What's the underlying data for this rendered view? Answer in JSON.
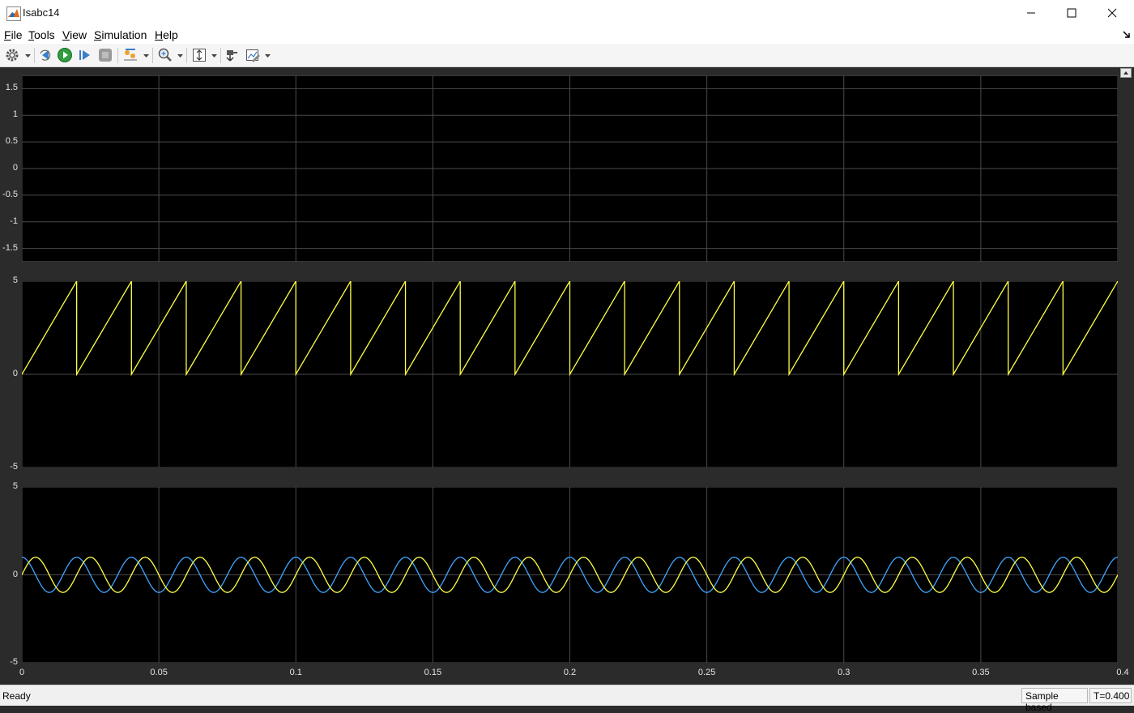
{
  "window": {
    "title": "Isabc14",
    "minimize_glyph": "—",
    "maximize_glyph": "☐",
    "close_glyph": "✕"
  },
  "menu": {
    "items": [
      {
        "first": "F",
        "rest": "ile"
      },
      {
        "first": "T",
        "rest": "ools"
      },
      {
        "first": "V",
        "rest": "iew"
      },
      {
        "first": "S",
        "rest": "imulation"
      },
      {
        "first": "H",
        "rest": "elp"
      }
    ]
  },
  "toolbar": {
    "icons": [
      "gear-icon",
      "step-back-icon",
      "run-icon",
      "step-forward-icon",
      "stop-icon",
      "signal-triggers-icon",
      "zoom-icon",
      "scale-axes-icon",
      "highlight-block-icon",
      "edit-axes-icon"
    ]
  },
  "status": {
    "left": "Ready",
    "sample_mode": "Sample based",
    "time": "T=0.400"
  },
  "colors": {
    "yellow": "#ffff44",
    "blue": "#3ea6ff",
    "axes_bg": "#000000",
    "grid": "#4a4a4a",
    "figure_bg": "#2b2b2b"
  },
  "chart_data": [
    {
      "type": "line",
      "x_ticks": [
        "0",
        "0.05",
        "0.1",
        "0.15",
        "0.2",
        "0.25",
        "0.3",
        "0.35",
        "0.4"
      ],
      "y_ticks": [
        "1.5",
        "1",
        "0.5",
        "0",
        "-0.5",
        "-1",
        "-1.5"
      ],
      "xlim": [
        0,
        0.4
      ],
      "ylim": [
        -1.75,
        1.75
      ],
      "grid": true,
      "series": []
    },
    {
      "type": "line",
      "x_ticks": [],
      "y_ticks": [
        "5",
        "0",
        "-5"
      ],
      "xlim": [
        0,
        0.4
      ],
      "ylim": [
        -5,
        5
      ],
      "grid": true,
      "series": [
        {
          "color": "#ffff44",
          "waveform": "sawtooth",
          "period": 0.02,
          "min": 0,
          "max": 5
        }
      ]
    },
    {
      "type": "line",
      "x_ticks": [
        "0",
        "0.05",
        "0.1",
        "0.15",
        "0.2",
        "0.25",
        "0.3",
        "0.35",
        "0.4"
      ],
      "y_ticks": [
        "5",
        "0",
        "-5"
      ],
      "xlim": [
        0,
        0.4
      ],
      "ylim": [
        -5,
        5
      ],
      "grid": true,
      "series": [
        {
          "color": "#3ea6ff",
          "waveform": "sine",
          "frequency": 50,
          "amplitude": 1,
          "phase_deg": 90
        },
        {
          "color": "#ffff44",
          "waveform": "sine",
          "frequency": 50,
          "amplitude": 1,
          "phase_deg": 0
        }
      ]
    }
  ]
}
